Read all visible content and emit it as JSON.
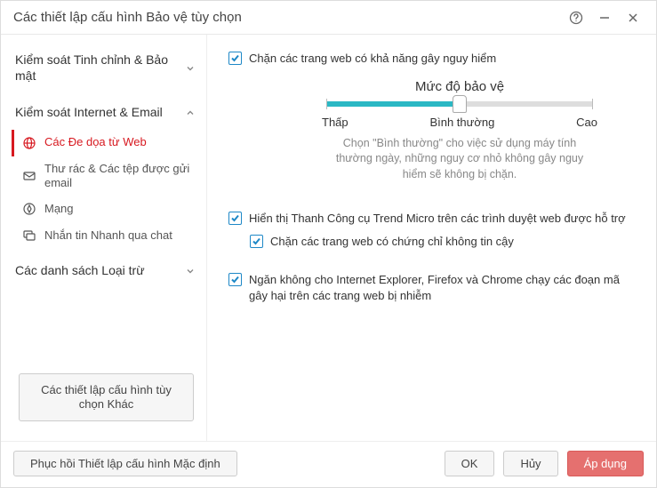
{
  "window": {
    "title": "Các thiết lập cấu hình Bảo vệ tùy chọn"
  },
  "sidebar": {
    "categories": [
      {
        "label": "Kiểm soát Tinh chỉnh & Bảo mật",
        "expanded": false
      },
      {
        "label": "Kiểm soát Internet & Email",
        "expanded": true
      },
      {
        "label": "Các danh sách Loại trừ",
        "expanded": false
      }
    ],
    "items": [
      {
        "label": "Các Đe dọa từ Web",
        "icon": "globe-icon",
        "active": true
      },
      {
        "label": "Thư rác & Các tệp được gửi email",
        "icon": "mail-icon",
        "active": false
      },
      {
        "label": "Mạng",
        "icon": "compass-icon",
        "active": false
      },
      {
        "label": "Nhắn tin Nhanh qua chat",
        "icon": "chat-icon",
        "active": false
      }
    ],
    "other_button": "Các thiết lập cấu hình tùy chọn Khác"
  },
  "content": {
    "chk_block": "Chặn các trang web có khả năng gây nguy hiểm",
    "slider": {
      "title": "Mức độ bảo vệ",
      "low": "Thấp",
      "mid": "Bình thường",
      "high": "Cao",
      "value": "Bình thường",
      "desc": "Chọn \"Bình thường\" cho việc sử dụng máy tính thường ngày, những nguy cơ nhỏ không gây nguy hiểm sẽ không bị chặn."
    },
    "chk_toolbar": "Hiển thị Thanh Công cụ Trend Micro trên các trình duyệt web được hỗ trợ",
    "chk_cert": "Chặn các trang web có chứng chỉ không tin cậy",
    "chk_script": "Ngăn không cho Internet Explorer, Firefox và Chrome chạy các đoạn mã gây hại trên các trang web bị nhiễm"
  },
  "footer": {
    "restore": "Phục hồi Thiết lập cấu hình Mặc định",
    "ok": "OK",
    "cancel": "Hủy",
    "apply": "Áp dụng"
  }
}
